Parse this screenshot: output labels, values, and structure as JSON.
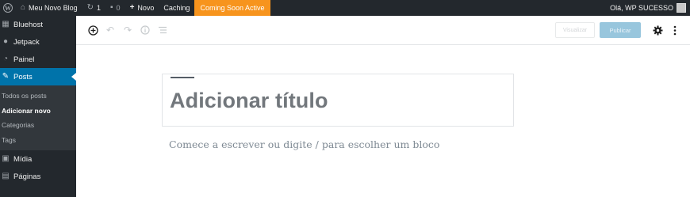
{
  "adminbar": {
    "site_name": "Meu Novo Blog",
    "updates_count": "1",
    "comments_count": "0",
    "new_label": "Novo",
    "caching_label": "Caching",
    "coming_soon_label": "Coming Soon Active",
    "greeting": "Olá, WP SUCESSO",
    "coming_soon_color": "#f7941d"
  },
  "sidebar": {
    "items": [
      {
        "label": "Bluehost",
        "icon": "bluehost-grid-icon"
      },
      {
        "label": "Jetpack",
        "icon": "jetpack-icon"
      },
      {
        "label": "Painel",
        "icon": "dashboard-icon"
      },
      {
        "label": "Posts",
        "icon": "pin-icon",
        "current": true
      }
    ],
    "submenu": [
      {
        "label": "Todos os posts"
      },
      {
        "label": "Adicionar novo",
        "active": true
      },
      {
        "label": "Categorias"
      },
      {
        "label": "Tags"
      }
    ],
    "items_after": [
      {
        "label": "Mídia",
        "icon": "media-icon"
      },
      {
        "label": "Páginas",
        "icon": "pages-icon"
      }
    ],
    "current_color": "#0073aa"
  },
  "toolbar": {
    "preview_label": "Visualizar",
    "publish_label": "Publicar"
  },
  "editor": {
    "title_placeholder": "Adicionar título",
    "body_placeholder": "Comece a escrever ou digite / para escolher um bloco"
  }
}
